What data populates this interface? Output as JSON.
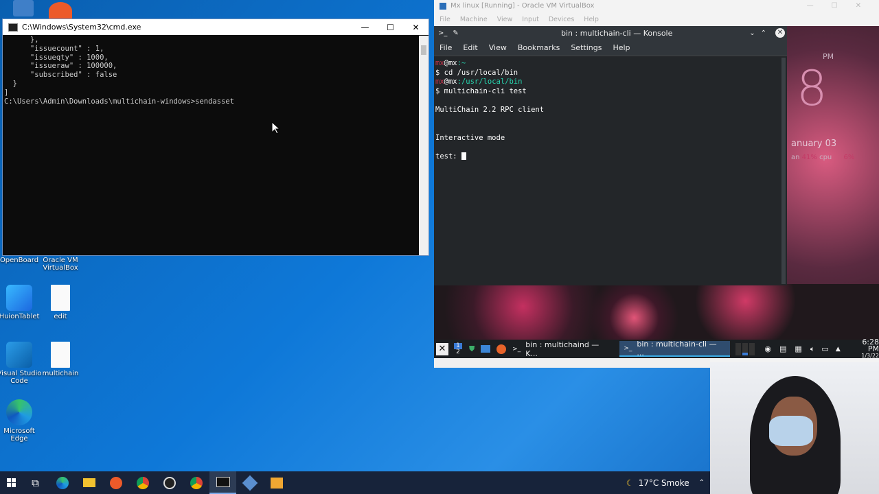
{
  "desktop": {
    "icons": [
      {
        "label": "OpenBoard"
      },
      {
        "label": "Oracle VM VirtualBox"
      },
      {
        "label": "HuionTablet"
      },
      {
        "label": "edit"
      },
      {
        "label": "Visual Studio Code"
      },
      {
        "label": "multichain"
      },
      {
        "label": "Microsoft Edge"
      }
    ]
  },
  "cmd": {
    "title": "C:\\Windows\\System32\\cmd.exe",
    "controls": {
      "minimize": "—",
      "maximize": "☐",
      "close": "✕"
    },
    "lines": [
      "      },",
      "      \"issuecount\" : 1,",
      "      \"issueqty\" : 1000,",
      "      \"issueraw\" : 100000,",
      "      \"subscribed\" : false",
      "  }",
      "]",
      "",
      "C:\\Users\\Admin\\Downloads\\multichain-windows>sendasset"
    ]
  },
  "vbox": {
    "title": "Mx linux [Running] - Oracle VM VirtualBox",
    "menu": [
      "File",
      "Machine",
      "View",
      "Input",
      "Devices",
      "Help"
    ]
  },
  "konsole": {
    "title": "bin : multichain-cli — Konsole",
    "menu": [
      "File",
      "Edit",
      "View",
      "Bookmarks",
      "Settings",
      "Help"
    ],
    "prompt1": {
      "user": "mx",
      "host": "@mx",
      "path": ":~"
    },
    "cmd1": "$ cd /usr/local/bin",
    "prompt2": {
      "user": "mx",
      "host": "@mx",
      "path": ":/usr/local/bin"
    },
    "cmd2": "$ multichain-cli test",
    "out1": "MultiChain 2.2 RPC client",
    "out2": "Interactive mode",
    "prompt3": "test: "
  },
  "conky": {
    "pm": "PM",
    "big_digit": "8",
    "date": "anuary 03",
    "cpu_prefix": "an",
    "cpu_val": "41%",
    "cpu_label": "cpu",
    "cpu2": "6%"
  },
  "guest_panel": {
    "workspace": "1",
    "workspace2": "2",
    "task1": "bin : multichaind — K...",
    "task2": "bin : multichain-cli — ...",
    "time": "6:28 PM",
    "date": "1/3/22"
  },
  "taskbar": {
    "weather": "17°C  Smoke"
  }
}
